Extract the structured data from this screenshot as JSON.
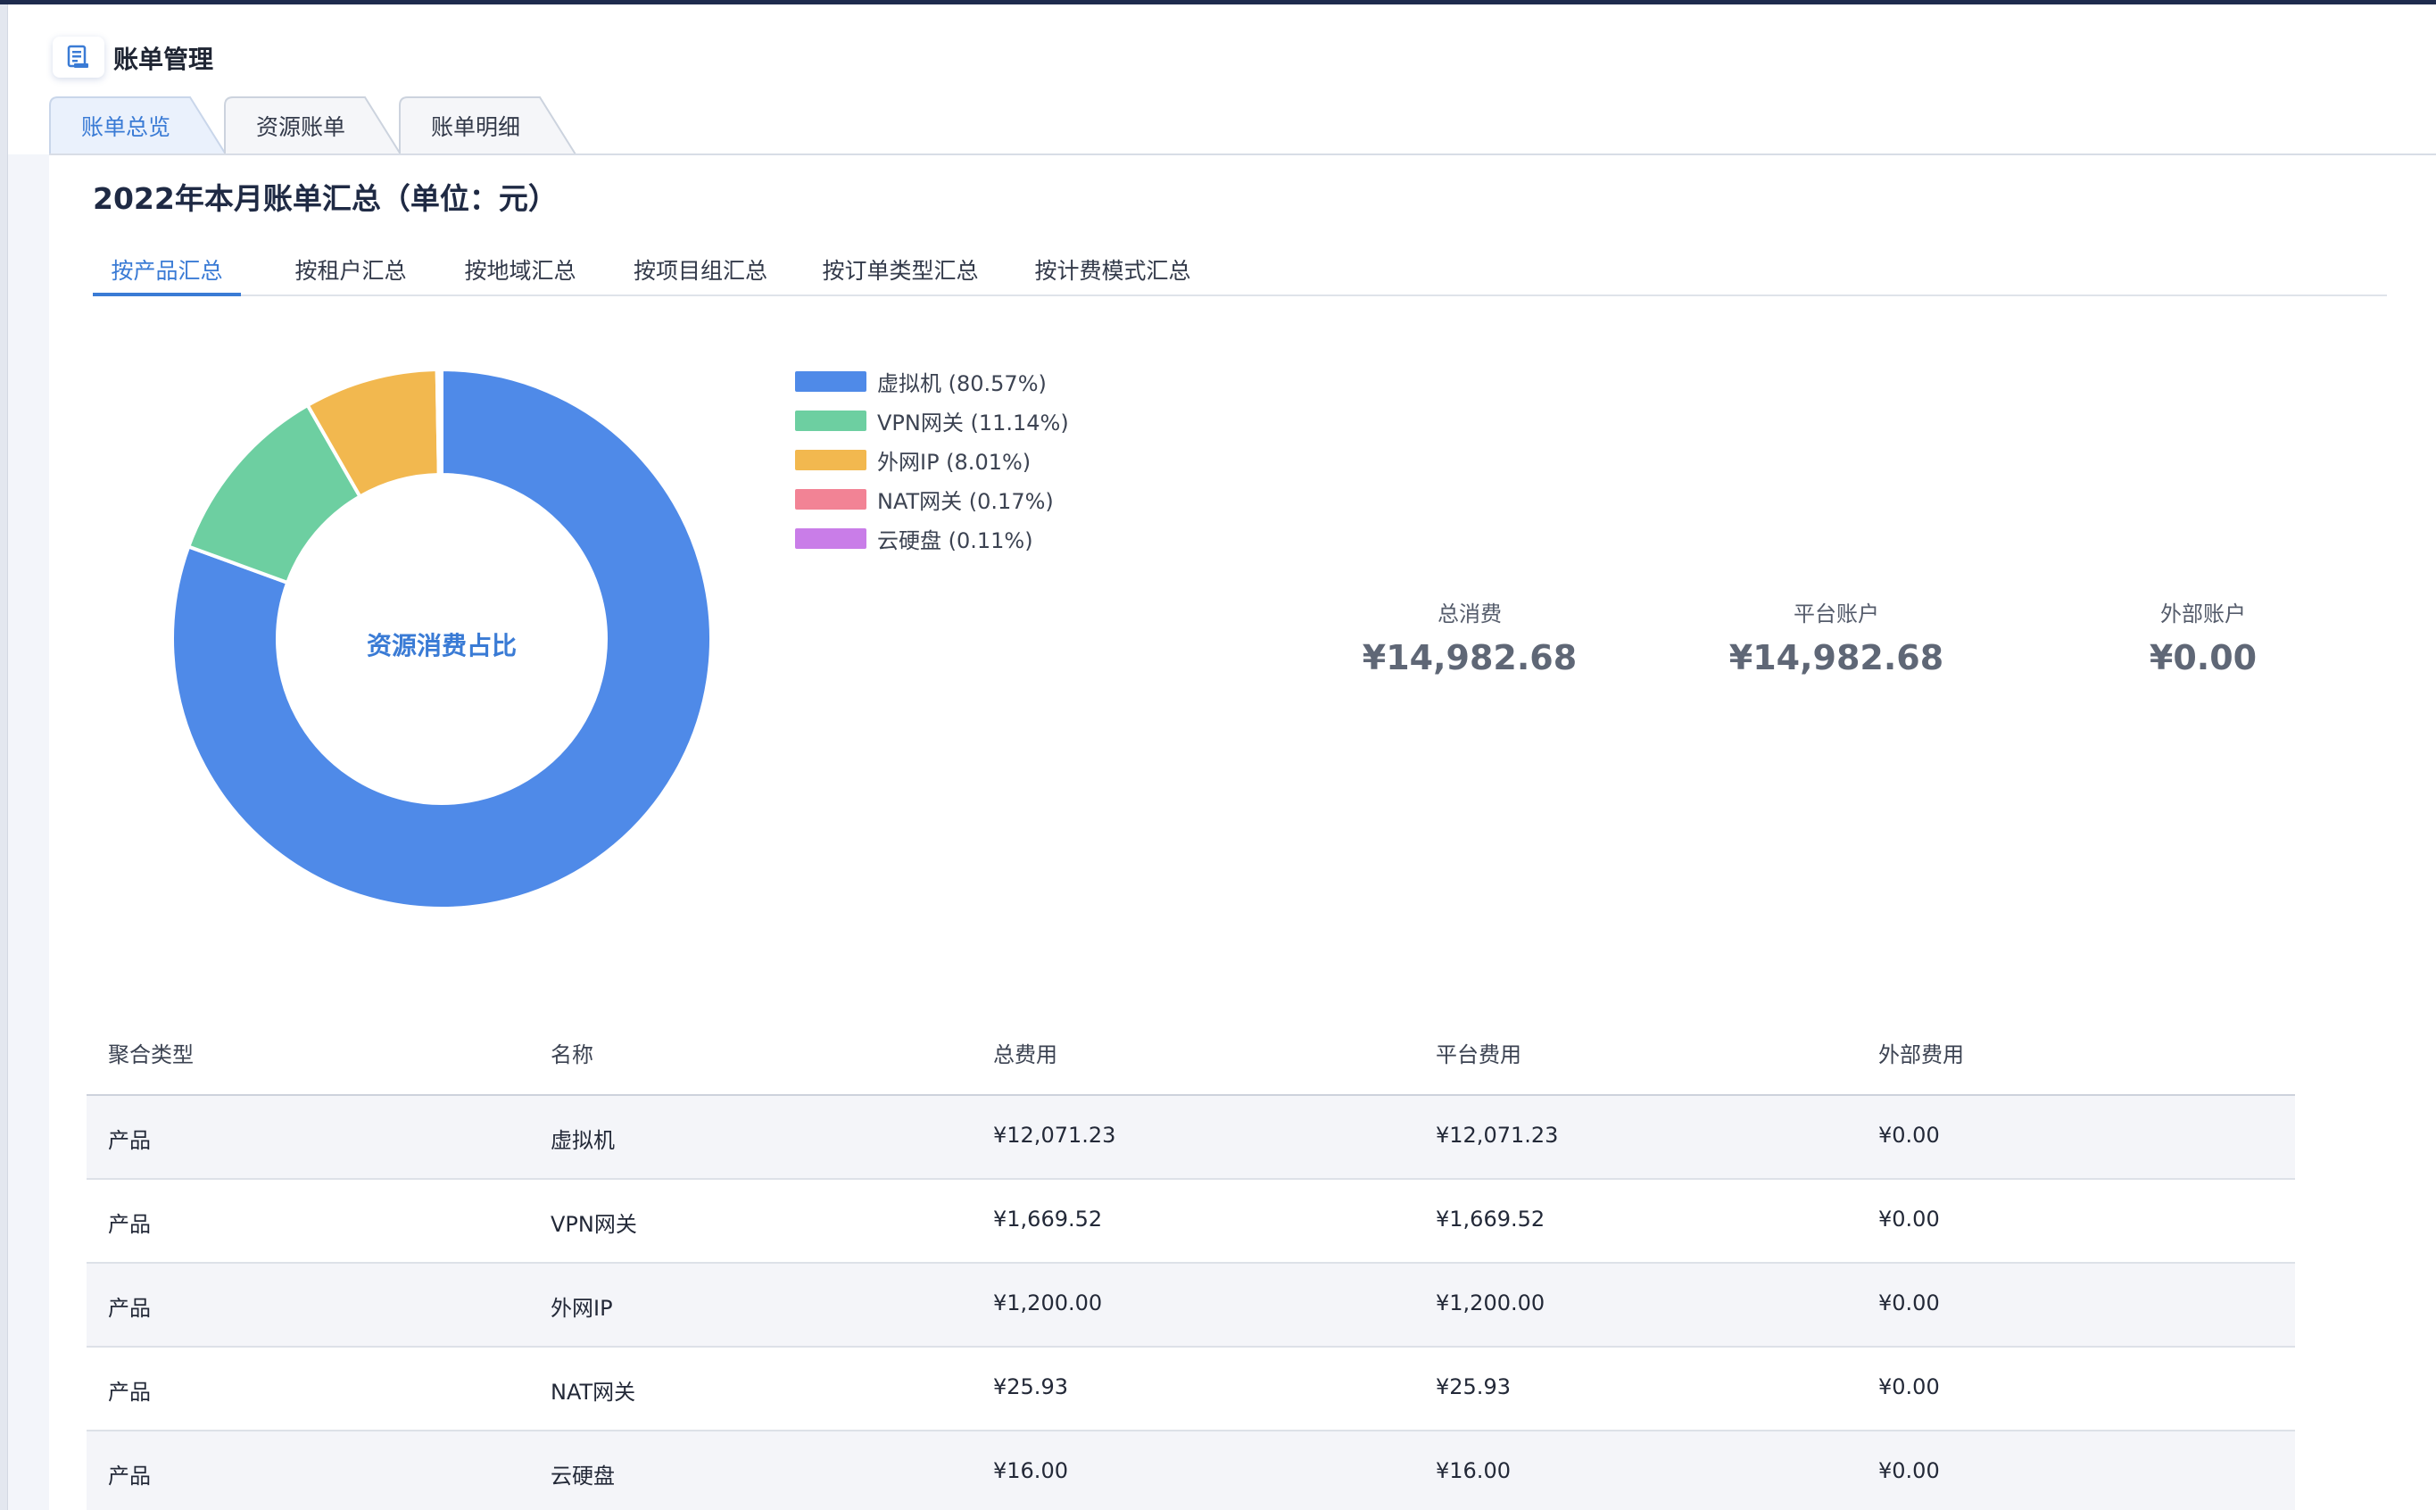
{
  "app": {
    "title": "账单管理",
    "icon": "bill-document-icon"
  },
  "main_tabs": [
    {
      "label": "账单总览",
      "active": true
    },
    {
      "label": "资源账单",
      "active": false
    },
    {
      "label": "账单明细",
      "active": false
    }
  ],
  "content": {
    "title": "2022年本月账单汇总（单位：元）"
  },
  "sub_tabs": [
    {
      "label": "按产品汇总",
      "active": true
    },
    {
      "label": "按租户汇总",
      "active": false
    },
    {
      "label": "按地域汇总",
      "active": false
    },
    {
      "label": "按项目组汇总",
      "active": false
    },
    {
      "label": "按订单类型汇总",
      "active": false
    },
    {
      "label": "按计费模式汇总",
      "active": false
    }
  ],
  "chart_data": {
    "type": "pie",
    "title": "资源消费占比",
    "slices": [
      {
        "label": "虚拟机",
        "percent": 80.57,
        "legend": "虚拟机 (80.57%)",
        "color": "#4f8ae8"
      },
      {
        "label": "VPN网关",
        "percent": 11.14,
        "legend": "VPN网关 (11.14%)",
        "color": "#6dcfa1"
      },
      {
        "label": "外网IP",
        "percent": 8.01,
        "legend": "外网IP (8.01%)",
        "color": "#f2b84f"
      },
      {
        "label": "NAT网关",
        "percent": 0.17,
        "legend": "NAT网关 (0.17%)",
        "color": "#f28395"
      },
      {
        "label": "云硬盘",
        "percent": 0.11,
        "legend": "云硬盘 (0.11%)",
        "color": "#c97de8"
      }
    ]
  },
  "stats": [
    {
      "label": "总消费",
      "value": "¥14,982.68"
    },
    {
      "label": "平台账户",
      "value": "¥14,982.68"
    },
    {
      "label": "外部账户",
      "value": "¥0.00"
    }
  ],
  "table": {
    "headers": [
      "聚合类型",
      "名称",
      "总费用",
      "平台费用",
      "外部费用"
    ],
    "rows": [
      [
        "产品",
        "虚拟机",
        "¥12,071.23",
        "¥12,071.23",
        "¥0.00"
      ],
      [
        "产品",
        "VPN网关",
        "¥1,669.52",
        "¥1,669.52",
        "¥0.00"
      ],
      [
        "产品",
        "外网IP",
        "¥1,200.00",
        "¥1,200.00",
        "¥0.00"
      ],
      [
        "产品",
        "NAT网关",
        "¥25.93",
        "¥25.93",
        "¥0.00"
      ],
      [
        "产品",
        "云硬盘",
        "¥16.00",
        "¥16.00",
        "¥0.00"
      ]
    ]
  }
}
